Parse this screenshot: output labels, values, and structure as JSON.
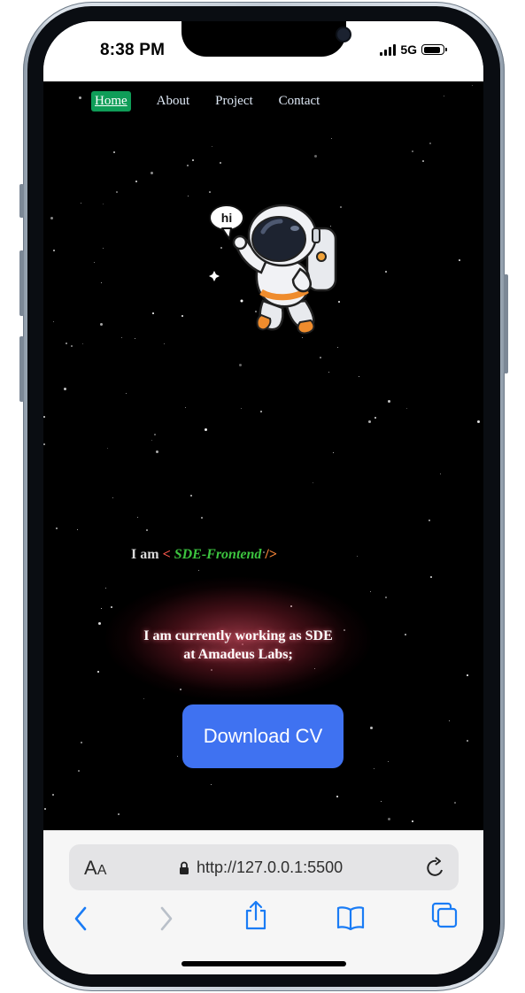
{
  "status_bar": {
    "time": "8:38 PM",
    "network": "5G",
    "battery_level": 0.9
  },
  "nav": {
    "items": [
      {
        "label": "Home",
        "active": true
      },
      {
        "label": "About",
        "active": false
      },
      {
        "label": "Project",
        "active": false
      },
      {
        "label": "Contact",
        "active": false
      }
    ]
  },
  "hero": {
    "speech_bubble": "hi",
    "iam_prefix": "I am",
    "bracket_open": "<",
    "role": "SDE-Frontend",
    "bracket_close": "/>",
    "working_line1": "I am currently working as SDE",
    "working_line2": "at Amadeus Labs;",
    "download_button": "Download CV"
  },
  "browser": {
    "text_size_label_big": "A",
    "text_size_label_small": "A",
    "url": "http://127.0.0.1:5500"
  },
  "colors": {
    "background": "#000000",
    "nav_active": "#0f9d58",
    "role_text": "#3cc43f",
    "bracket": "#ff5a4e",
    "button": "#3f72f1",
    "safari_accent": "#1a7cf5"
  }
}
